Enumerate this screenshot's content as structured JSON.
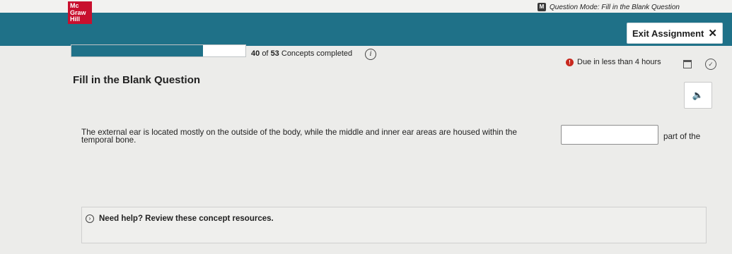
{
  "header": {
    "logo_lines": [
      "Mc",
      "Graw",
      "Hill"
    ],
    "mode_badge": "M",
    "mode_text": "Question Mode: Fill in the Blank Question",
    "exit_label": "Exit Assignment",
    "exit_icon": "close-icon"
  },
  "progress": {
    "completed": "40",
    "of_text": "of",
    "total": "53",
    "label": "Concepts completed",
    "fraction": 0.755,
    "info_glyph": "i"
  },
  "due": {
    "icon_glyph": "!",
    "text": "Due in less than 4 hours"
  },
  "question": {
    "title": "Fill in the Blank Question",
    "text_before": "The external ear is located mostly on the outside of the body, while the middle and inner ear areas are housed within the",
    "blank_value": "",
    "text_after": "part of the",
    "text_line2": "temporal bone."
  },
  "help": {
    "label": "Need help? Review these concept resources."
  },
  "colors": {
    "brand_red": "#c8102e",
    "teal": "#1f7188",
    "warning_red": "#c8281e"
  }
}
